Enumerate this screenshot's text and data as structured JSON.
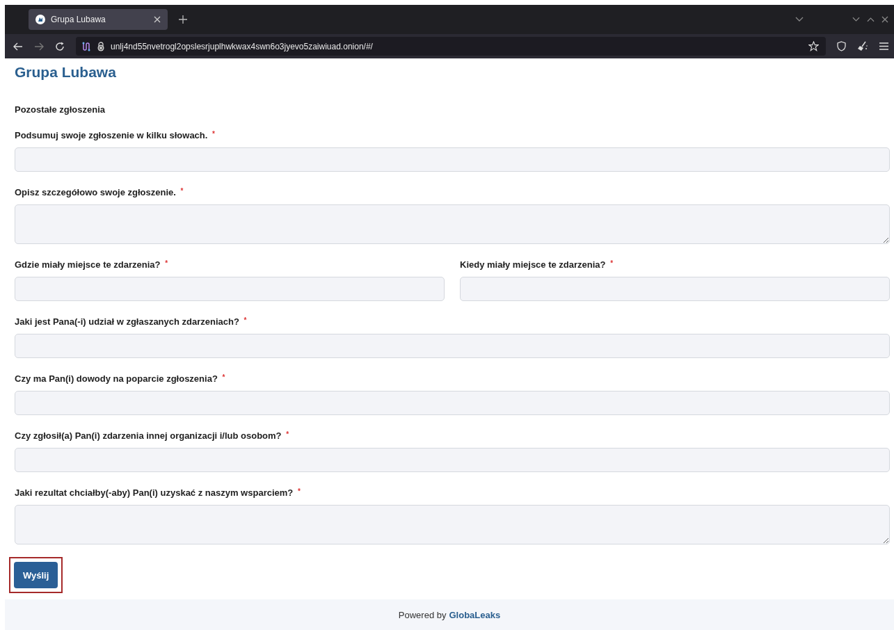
{
  "browser": {
    "tab": {
      "title": "Grupa Lubawa",
      "selected": true
    },
    "url": "unlj4nd55nvetrogl2opslesrjuplhwkwax4swn6o3jyevo5zaiwiuad.onion/#/"
  },
  "page": {
    "title": "Grupa Lubawa",
    "section": "Pozostałe zgłoszenia",
    "rows": [
      {
        "fields": [
          {
            "label": "Podsumuj swoje zgłoszenie w kilku słowach.",
            "required_mark": "*",
            "kind": "input"
          }
        ]
      },
      {
        "fields": [
          {
            "label": "Opisz szczegółowo swoje zgłoszenie.",
            "required_mark": "*",
            "kind": "textarea"
          }
        ]
      },
      {
        "fields": [
          {
            "label": "Gdzie miały miejsce te zdarzenia?",
            "required_mark": "*",
            "kind": "input"
          },
          {
            "label": "Kiedy miały miejsce te zdarzenia?",
            "required_mark": "*",
            "kind": "input"
          }
        ]
      },
      {
        "fields": [
          {
            "label": "Jaki jest Pana(-i) udział w zgłaszanych zdarzeniach?",
            "required_mark": "*",
            "kind": "input"
          }
        ]
      },
      {
        "fields": [
          {
            "label": "Czy ma Pan(i) dowody na poparcie zgłoszenia?",
            "required_mark": "*",
            "kind": "input"
          }
        ]
      },
      {
        "fields": [
          {
            "label": "Czy zgłosił(a) Pan(i) zdarzenia innej organizacji i/lub osobom?",
            "required_mark": "*",
            "kind": "input"
          }
        ]
      },
      {
        "fields": [
          {
            "label": "Jaki rezultat chciałby(-aby) Pan(i) uzyskać z naszym wsparciem?",
            "required_mark": "*",
            "kind": "textarea"
          }
        ]
      }
    ],
    "submit": {
      "label": "Wyślij",
      "highlighted": true
    }
  },
  "footer": {
    "text": "Powered by",
    "link": "GlobaLeaks"
  }
}
